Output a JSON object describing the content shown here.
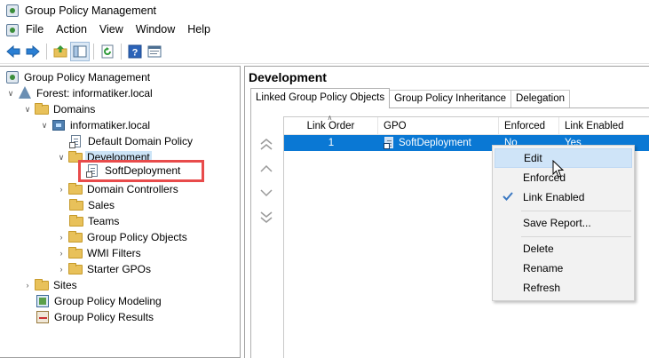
{
  "window": {
    "title": "Group Policy Management"
  },
  "menu": {
    "items": [
      "File",
      "Action",
      "View",
      "Window",
      "Help"
    ]
  },
  "toolbar": {
    "buttons": [
      "back-icon",
      "forward-icon",
      "up-folder-icon",
      "show-hide-tree-icon",
      "refresh-icon",
      "help-icon",
      "properties-icon"
    ]
  },
  "tree": {
    "root": "Group Policy Management",
    "forest": "Forest: informatiker.local",
    "domains": "Domains",
    "domain": "informatiker.local",
    "default_policy": "Default Domain Policy",
    "development": "Development",
    "soft_deployment": "SoftDeployment",
    "domain_controllers": "Domain Controllers",
    "sales": "Sales",
    "teams": "Teams",
    "gpo_folder": "Group Policy Objects",
    "wmi_filters": "WMI Filters",
    "starter_gpos": "Starter GPOs",
    "sites": "Sites",
    "modeling": "Group Policy Modeling",
    "results": "Group Policy Results"
  },
  "details": {
    "title": "Development",
    "tabs": [
      "Linked Group Policy Objects",
      "Group Policy Inheritance",
      "Delegation"
    ],
    "columns": {
      "order": "Link Order",
      "gpo": "GPO",
      "enforced": "Enforced",
      "link_enabled": "Link Enabled"
    },
    "rows": [
      {
        "order": "1",
        "gpo": "SoftDeployment",
        "enforced": "No",
        "link_enabled": "Yes"
      }
    ]
  },
  "context_menu": {
    "edit": "Edit",
    "enforced": "Enforced",
    "link_enabled": "Link Enabled",
    "save_report": "Save Report...",
    "delete": "Delete",
    "rename": "Rename",
    "refresh": "Refresh"
  },
  "colors": {
    "selection": "#0a78d4",
    "highlight_box": "#e84b4b",
    "menu_hover": "#cfe4f8"
  }
}
